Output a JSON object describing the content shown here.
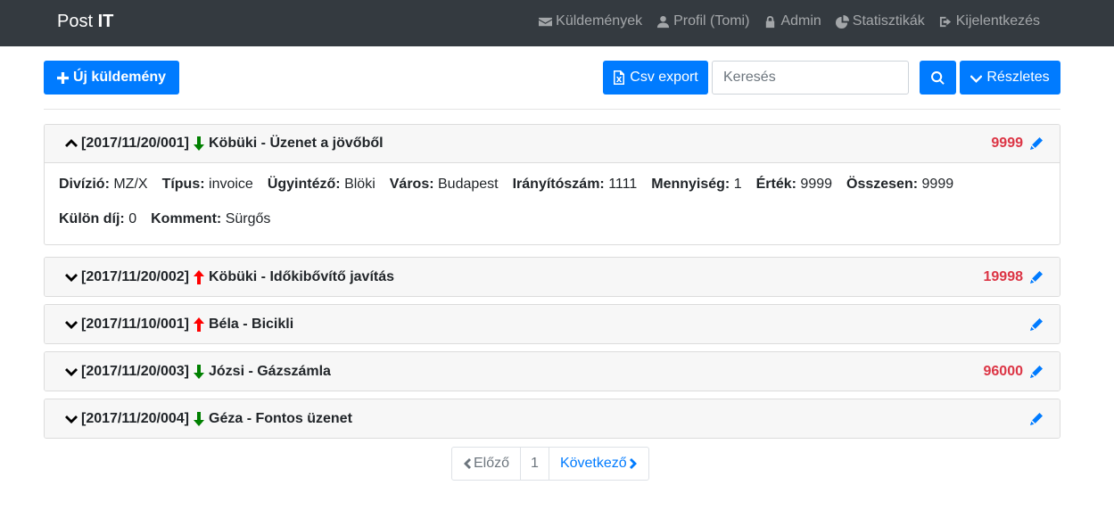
{
  "navbar": {
    "brand_prefix": "Post ",
    "brand_bold": "IT",
    "items": [
      {
        "label": "Küldemények",
        "icon": "envelope-icon"
      },
      {
        "label": "Profil (Tomi)",
        "icon": "user-icon"
      },
      {
        "label": "Admin",
        "icon": "lock-icon"
      },
      {
        "label": "Statisztikák",
        "icon": "pie-chart-icon"
      },
      {
        "label": "Kijelentkezés",
        "icon": "logout-icon"
      }
    ]
  },
  "toolbar": {
    "new_label": "Új küldemény",
    "csv_label": "Csv export",
    "search_placeholder": "Keresés",
    "search_value": "",
    "details_label": "Részletes"
  },
  "items": [
    {
      "id": "[2017/11/20/001]",
      "direction": "down",
      "title": "Köbüki - Üzenet a jövőből",
      "amount": "9999",
      "expanded": true,
      "details_row1": [
        {
          "label": "Divízió:",
          "value": "MZ/X"
        },
        {
          "label": "Típus:",
          "value": "invoice"
        },
        {
          "label": "Ügyintéző:",
          "value": "Blöki"
        },
        {
          "label": "Város:",
          "value": "Budapest"
        },
        {
          "label": "Irányítószám:",
          "value": "1111"
        },
        {
          "label": "Mennyiség:",
          "value": "1"
        },
        {
          "label": "Érték:",
          "value": "9999"
        },
        {
          "label": "Összesen:",
          "value": "9999"
        }
      ],
      "details_row2": [
        {
          "label": "Külön díj:",
          "value": "0"
        },
        {
          "label": "Komment:",
          "value": "Sürgős"
        }
      ]
    },
    {
      "id": "[2017/11/20/002]",
      "direction": "up",
      "title": "Köbüki - Időkibővítő javítás",
      "amount": "19998",
      "expanded": false
    },
    {
      "id": "[2017/11/10/001]",
      "direction": "up",
      "title": "Béla - Bicikli",
      "amount": "",
      "expanded": false
    },
    {
      "id": "[2017/11/20/003]",
      "direction": "down",
      "title": "Józsi - Gázszámla",
      "amount": "96000",
      "expanded": false
    },
    {
      "id": "[2017/11/20/004]",
      "direction": "down",
      "title": "Géza - Fontos üzenet",
      "amount": "",
      "expanded": false
    }
  ],
  "pagination": {
    "prev_label": "Előző",
    "current_page": "1",
    "next_label": "Következő"
  },
  "colors": {
    "navbar_bg": "#343a40",
    "primary": "#007bff",
    "amount": "#dc3545",
    "arrow_up": "#ff0000",
    "arrow_down": "#008000"
  }
}
